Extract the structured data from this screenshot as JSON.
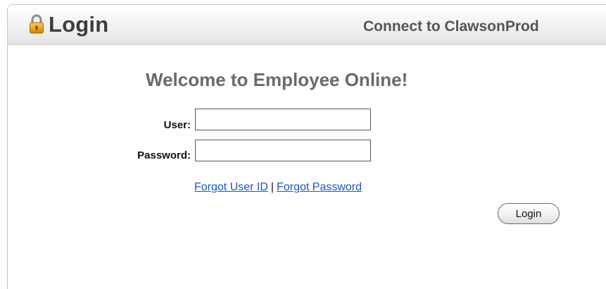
{
  "header": {
    "title": "Login",
    "connect_text": "Connect to ClawsonProd",
    "icon": "lock-icon"
  },
  "form": {
    "welcome": "Welcome to Employee Online!",
    "user_label": "User:",
    "user_value": "",
    "password_label": "Password:",
    "password_value": "",
    "forgot_user_id": "Forgot User ID",
    "separator": "|",
    "forgot_password": "Forgot Password",
    "login_button": "Login"
  },
  "colors": {
    "link": "#1558c6",
    "lock_gold": "#e9a21c"
  }
}
